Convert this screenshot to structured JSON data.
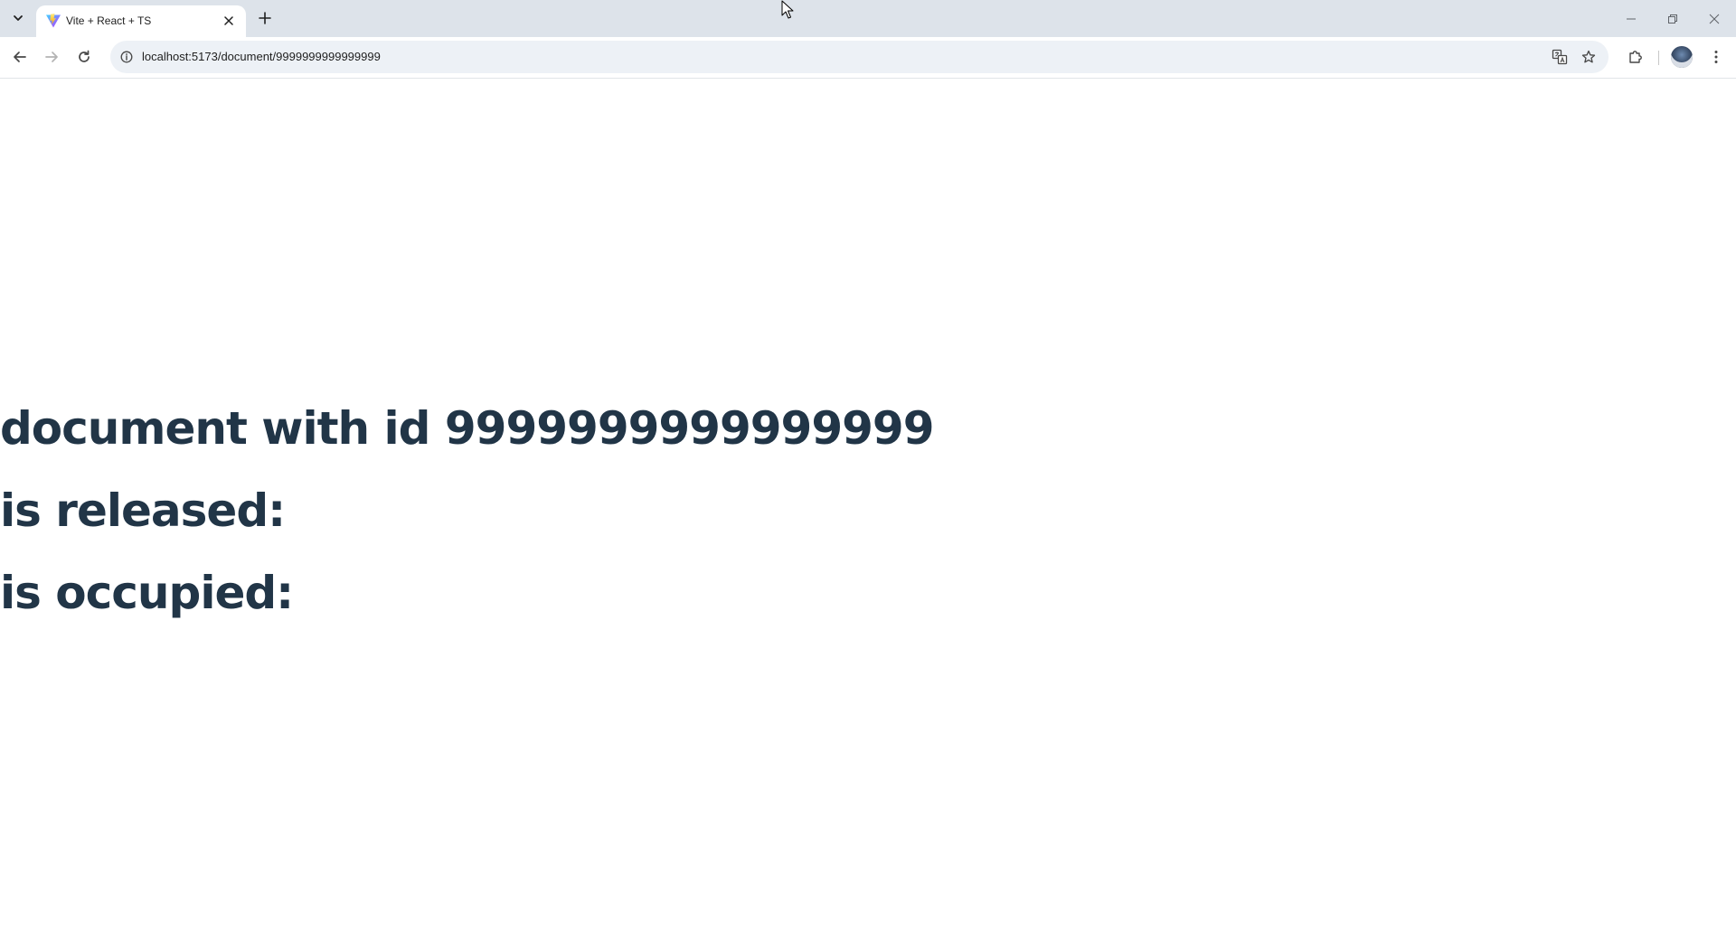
{
  "browser": {
    "tab": {
      "title": "Vite + React + TS",
      "favicon": "vite-logo-icon"
    },
    "address_bar": {
      "url": "localhost:5173/document/9999999999999999"
    },
    "icons": {
      "tab_search": "chevron-down-icon",
      "tab_close": "close-icon",
      "new_tab": "plus-icon",
      "back": "arrow-left-icon",
      "forward": "arrow-right-icon",
      "reload": "reload-icon",
      "site_info": "info-icon",
      "translate": "translate-icon",
      "bookmark": "star-icon",
      "extensions": "puzzle-icon",
      "profile": "avatar",
      "menu": "kebab-menu-icon",
      "minimize": "minimize-icon",
      "restore": "restore-icon",
      "close_window": "close-icon"
    }
  },
  "page": {
    "line1": "document with id 9999999999999999",
    "line2": "is released:",
    "line3": "is occupied:"
  },
  "colors": {
    "text": "#213547",
    "tabstrip": "#dde3ea",
    "omnibox": "#edf1f6"
  }
}
